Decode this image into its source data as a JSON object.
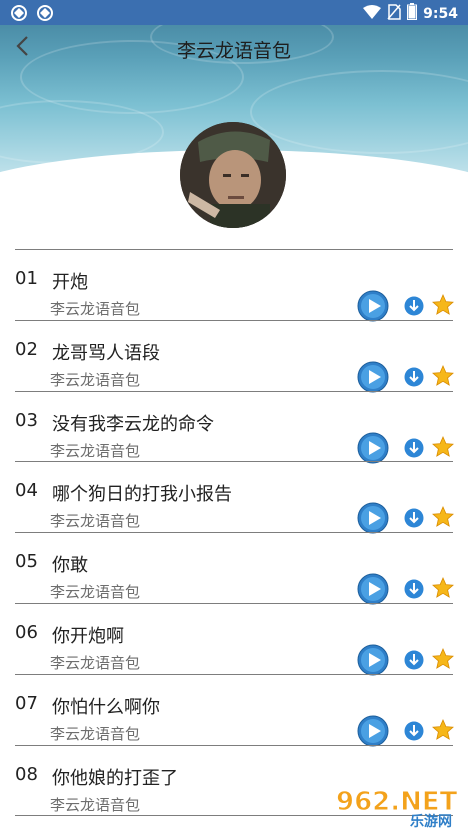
{
  "status_bar": {
    "time": "9:54"
  },
  "header": {
    "title": "李云龙语音包"
  },
  "tracks": [
    {
      "num": "01",
      "title": "开炮",
      "artist": "李云龙语音包"
    },
    {
      "num": "02",
      "title": "龙哥骂人语段",
      "artist": "李云龙语音包"
    },
    {
      "num": "03",
      "title": "没有我李云龙的命令",
      "artist": "李云龙语音包"
    },
    {
      "num": "04",
      "title": "哪个狗日的打我小报告",
      "artist": "李云龙语音包"
    },
    {
      "num": "05",
      "title": "你敢",
      "artist": "李云龙语音包"
    },
    {
      "num": "06",
      "title": "你开炮啊",
      "artist": "李云龙语音包"
    },
    {
      "num": "07",
      "title": "你怕什么啊你",
      "artist": "李云龙语音包"
    },
    {
      "num": "08",
      "title": "你他娘的打歪了",
      "artist": "李云龙语音包"
    }
  ],
  "watermark": {
    "text": "962.NET",
    "sub": "乐游网"
  }
}
